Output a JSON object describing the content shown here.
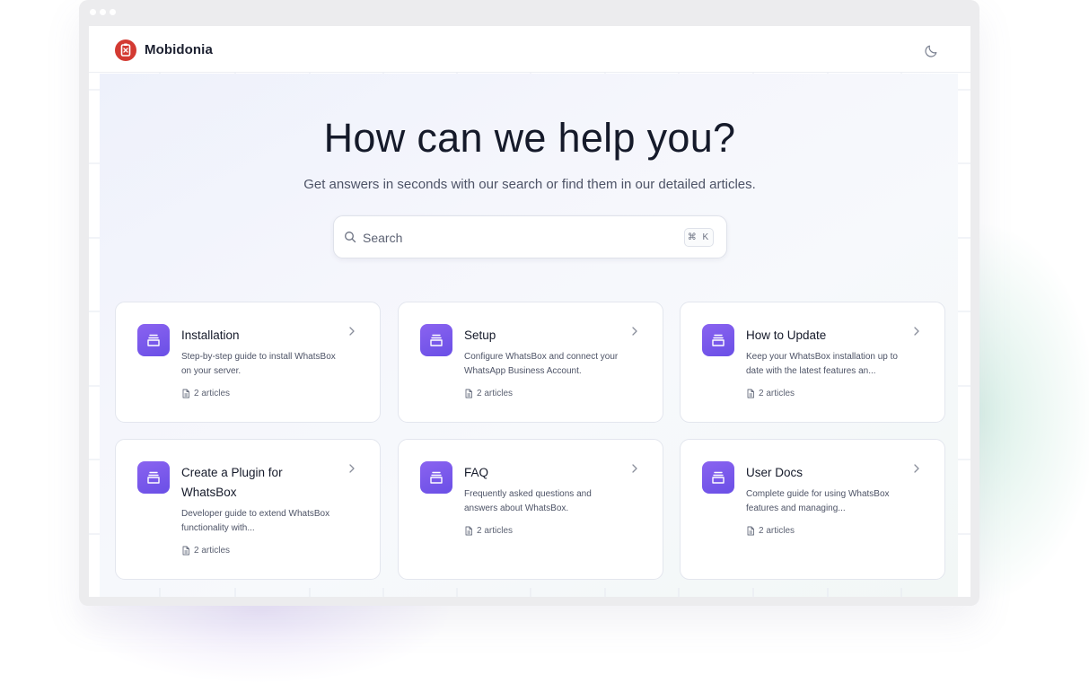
{
  "brand": {
    "name": "Mobidonia",
    "accent": "#d33a32"
  },
  "header": {
    "theme_toggle_icon": "moon-icon"
  },
  "hero": {
    "title": "How can we help you?",
    "subtitle": "Get answers in seconds with our search or find them in our detailed articles."
  },
  "search": {
    "placeholder": "Search",
    "shortcut": "⌘ K",
    "icon": "search-icon"
  },
  "categories": [
    {
      "title": "Installation",
      "description": "Step-by-step guide to install WhatsBox on your server.",
      "meta": "2 articles"
    },
    {
      "title": "Setup",
      "description": "Configure WhatsBox and connect your WhatsApp Business Account.",
      "meta": "2 articles"
    },
    {
      "title": "How to Update",
      "description": "Keep your WhatsBox installation up to date with the latest features an...",
      "meta": "2 articles"
    },
    {
      "title": "Create a Plugin for WhatsBox",
      "description": "Developer guide to extend WhatsBox functionality with...",
      "meta": "2 articles"
    },
    {
      "title": "FAQ",
      "description": "Frequently asked questions and answers about WhatsBox.",
      "meta": "2 articles"
    },
    {
      "title": "User Docs",
      "description": "Complete guide for using WhatsBox features and managing...",
      "meta": "2 articles"
    }
  ],
  "colors": {
    "category_icon": "#7b5af0",
    "title": "#151a2a"
  }
}
